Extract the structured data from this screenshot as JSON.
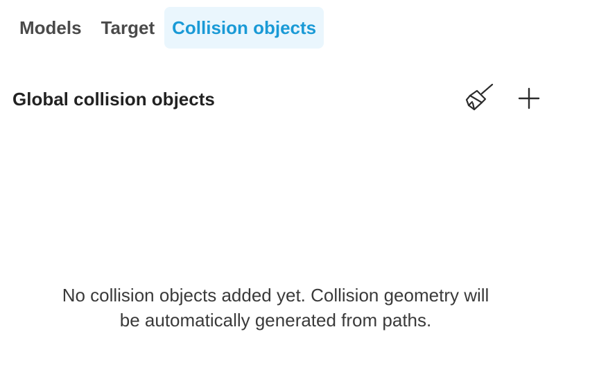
{
  "tabs": [
    {
      "label": "Models",
      "active": false
    },
    {
      "label": "Target",
      "active": false
    },
    {
      "label": "Collision objects",
      "active": true
    }
  ],
  "section": {
    "title": "Global collision objects",
    "actions": [
      {
        "icon": "broom-icon",
        "purpose": "clear"
      },
      {
        "icon": "plus-icon",
        "purpose": "add"
      }
    ]
  },
  "empty_state": {
    "line1": "No collision objects added yet. Collision geometry will",
    "line2": "be automatically generated from paths."
  },
  "colors": {
    "accent": "#1a9ad6",
    "active_tab_bg": "#eaf6fd",
    "text": "#2b2b2b"
  }
}
